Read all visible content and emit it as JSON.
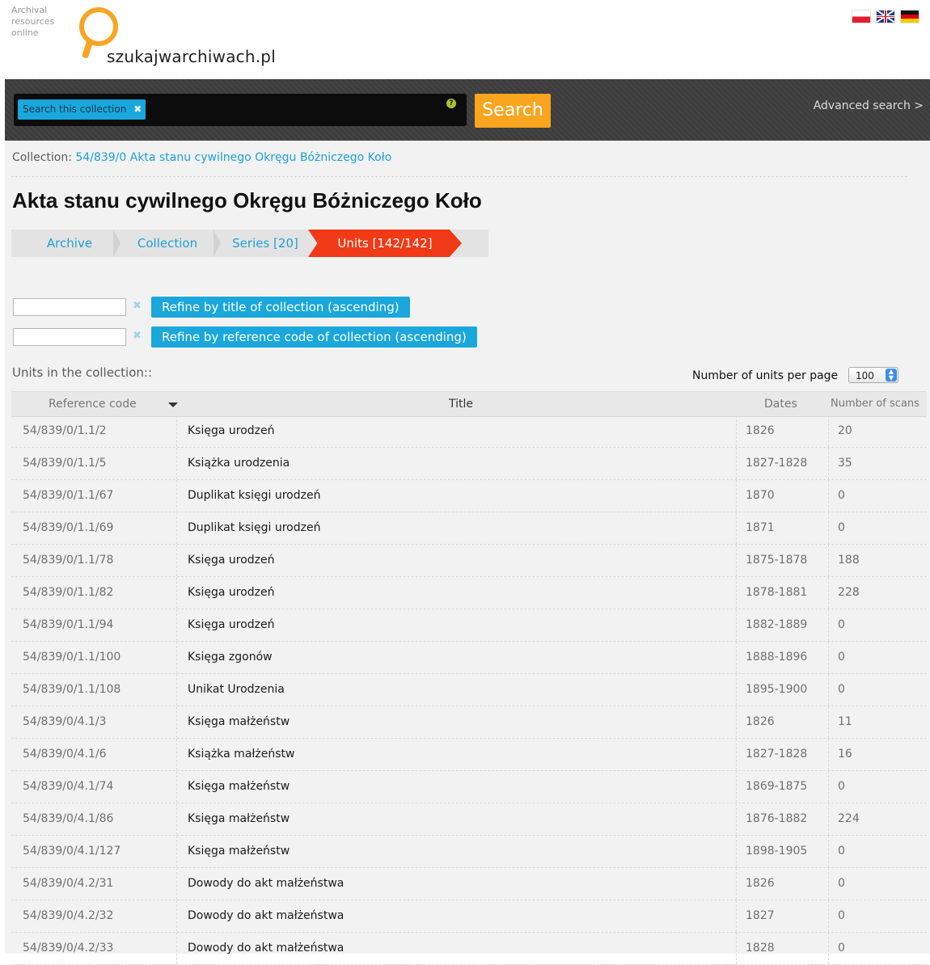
{
  "header": {
    "tagline": [
      "Archival",
      "resources",
      "online"
    ],
    "logo_text": "szukajwarchiwach.pl",
    "flags": [
      "pl",
      "gb",
      "de"
    ]
  },
  "search": {
    "scope_chip": "Search this collection",
    "button_label": "Search",
    "advanced_link": "Advanced search >"
  },
  "breadcrumb": {
    "prefix": "Collection:",
    "link": "54/839/0 Akta stanu cywilnego Okręgu Bóżniczego Koło"
  },
  "page_title": "Akta stanu cywilnego Okręgu Bóżniczego Koło",
  "tabs": [
    {
      "label": "Archive"
    },
    {
      "label": "Collection"
    },
    {
      "label": "Series [20]"
    },
    {
      "label": "Units [142/142]",
      "active": true
    }
  ],
  "refine": [
    {
      "button": "Refine by title of collection (ascending)"
    },
    {
      "button": "Refine by reference code of collection (ascending)"
    }
  ],
  "units_label": "Units in the collection::",
  "per_page": {
    "label": "Number of units per page",
    "value": "100"
  },
  "table": {
    "columns": [
      "Reference code",
      "Title",
      "Dates",
      "Number of scans"
    ],
    "rows": [
      [
        "54/839/0/1.1/2",
        "Księga urodzeń",
        "1826",
        "20"
      ],
      [
        "54/839/0/1.1/5",
        "Książka urodzenia",
        "1827-1828",
        "35"
      ],
      [
        "54/839/0/1.1/67",
        "Duplikat księgi urodzeń",
        "1870",
        "0"
      ],
      [
        "54/839/0/1.1/69",
        "Duplikat księgi urodzeń",
        "1871",
        "0"
      ],
      [
        "54/839/0/1.1/78",
        "Księga urodzeń",
        "1875-1878",
        "188"
      ],
      [
        "54/839/0/1.1/82",
        "Księga urodzeń",
        "1878-1881",
        "228"
      ],
      [
        "54/839/0/1.1/94",
        "Księga urodzeń",
        "1882-1889",
        "0"
      ],
      [
        "54/839/0/1.1/100",
        "Księga zgonów",
        "1888-1896",
        "0"
      ],
      [
        "54/839/0/1.1/108",
        "Unikat Urodzenia",
        "1895-1900",
        "0"
      ],
      [
        "54/839/0/4.1/3",
        "Księga małżeństw",
        "1826",
        "11"
      ],
      [
        "54/839/0/4.1/6",
        "Książka małżeństw",
        "1827-1828",
        "16"
      ],
      [
        "54/839/0/4.1/74",
        "Księga małżeństw",
        "1869-1875",
        "0"
      ],
      [
        "54/839/0/4.1/86",
        "Księga małżeństw",
        "1876-1882",
        "224"
      ],
      [
        "54/839/0/4.1/127",
        "Księga małżeństw",
        "1898-1905",
        "0"
      ],
      [
        "54/839/0/4.2/31",
        "Dowody do akt małżeństwa",
        "1826",
        "0"
      ],
      [
        "54/839/0/4.2/32",
        "Dowody do akt małżeństwa",
        "1827",
        "0"
      ],
      [
        "54/839/0/4.2/33",
        "Dowody do akt małżeństwa",
        "1828",
        "0"
      ]
    ]
  },
  "colors": {
    "accent_blue": "#1aa7db",
    "search_orange": "#f9a520",
    "active_tab_red": "#f03a17",
    "logo_orange": "#f6a623"
  }
}
